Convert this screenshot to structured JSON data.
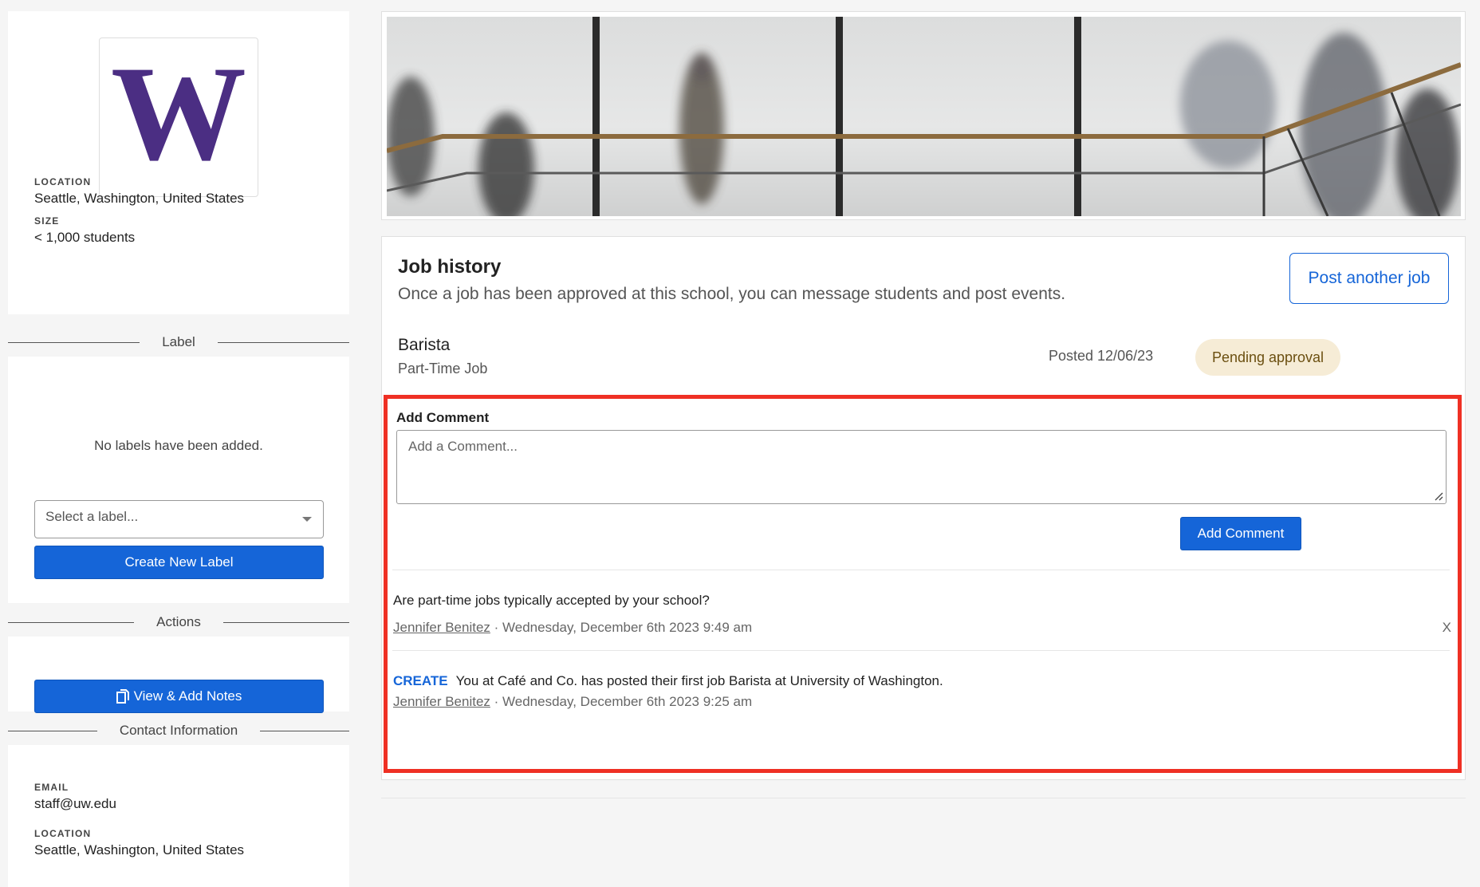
{
  "sidebar": {
    "school": {
      "logo_letter": "W",
      "logo_color": "#4b2e83",
      "location_label": "LOCATION",
      "location": "Seattle, Washington, United States",
      "size_label": "SIZE",
      "size": "< 1,000 students"
    },
    "labels": {
      "heading": "Label",
      "empty_text": "No labels have been added.",
      "select_placeholder": "Select a label...",
      "create_button": "Create New Label"
    },
    "actions": {
      "heading": "Actions",
      "notes_button": "View & Add Notes"
    },
    "contact": {
      "heading": "Contact Information",
      "email_label": "EMAIL",
      "email": "staff@uw.edu",
      "location_label": "LOCATION",
      "location": "Seattle, Washington, United States"
    }
  },
  "job_history": {
    "title": "Job history",
    "subtitle": "Once a job has been approved at this school, you can message students and post events.",
    "post_button": "Post another job",
    "job": {
      "title": "Barista",
      "type": "Part-Time Job",
      "posted": "Posted 12/06/23",
      "status": "Pending approval"
    }
  },
  "comments": {
    "label": "Add Comment",
    "placeholder": "Add a Comment...",
    "submit_button": "Add Comment",
    "items": [
      {
        "text": "Are part-time jobs typically accepted by your school?",
        "author": "Jennifer Benitez",
        "timestamp": " · Wednesday, December 6th 2023 9:49 am",
        "close": "X"
      },
      {
        "tag": "CREATE",
        "text": "You at Café and Co. has posted their first job Barista at University of Washington.",
        "author": "Jennifer Benitez",
        "timestamp": " · Wednesday, December 6th 2023 9:25 am"
      }
    ]
  },
  "colors": {
    "primary": "#1565d8",
    "highlight": "#ef3024",
    "badge_bg": "#f6ecd6",
    "uw_purple": "#4b2e83"
  }
}
